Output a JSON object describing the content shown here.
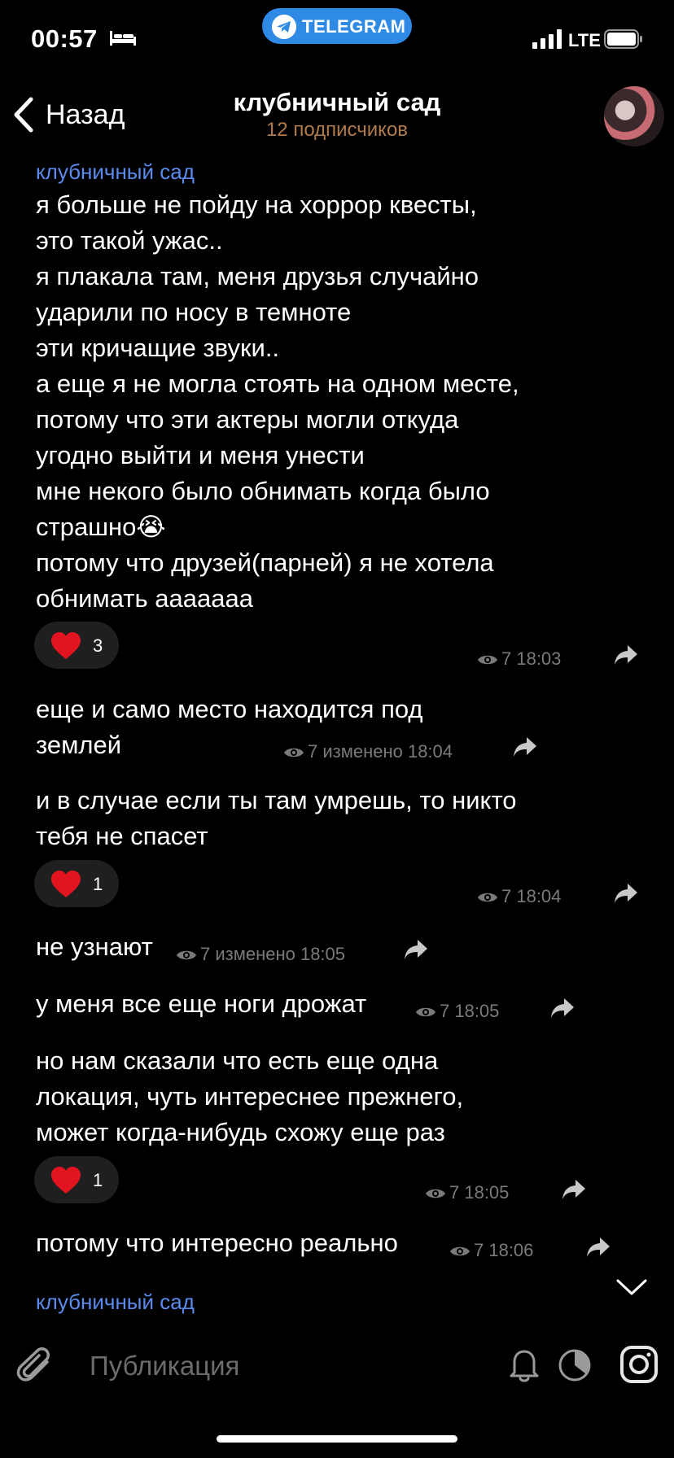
{
  "status_bar": {
    "time": "00:57",
    "tg_label": "TELEGRAM",
    "network": "LTE"
  },
  "header": {
    "back_label": "Назад",
    "title": "клубничный сад",
    "subtitle": "12 подписчиков"
  },
  "messages": {
    "m1": {
      "author": "клубничный сад",
      "text": "я больше не пойду на хоррор квесты,\nэто такой ужас..\nя плакала там, меня друзья случайно\nударили по носу в темноте\nэти кричащие звуки..\nа еще я не могла стоять на одном месте,\nпотому что эти актеры могли откуда\nугодно выйти и меня унести\nмне некого было обнимать когда было\nстрашно😭\nпотому что друзей(парней) я не хотела\nобнимать аааааaa",
      "reaction_count": "3",
      "meta": "7 18:03"
    },
    "m2": {
      "text": "еще и само место находится под\nземлей",
      "meta": "7 изменено 18:04"
    },
    "m3": {
      "text": "и в случае если ты там умрешь, то никто\nтебя не спасет",
      "reaction_count": "1",
      "meta": "7 18:04"
    },
    "m4": {
      "text": "не узнают",
      "meta": "7 изменено 18:05"
    },
    "m5": {
      "text": "у меня все еще ноги дрожат",
      "meta": "7 18:05"
    },
    "m6": {
      "text": "но нам сказали что есть еще одна\nлокация, чуть интереснее прежнего,\nможет когда-нибудь схожу еще раз",
      "reaction_count": "1",
      "meta": "7 18:05"
    },
    "m7": {
      "text": "потому что интересно реально",
      "meta": "7 18:06"
    },
    "m8": {
      "author": "клубничный сад"
    }
  },
  "composer": {
    "placeholder": "Публикация"
  },
  "icons": [
    "bed-icon",
    "telegram-icon",
    "signal-icon",
    "battery-icon",
    "chevron-left-icon",
    "heart-icon",
    "eye-icon",
    "share-icon",
    "chevron-down-icon",
    "paperclip-icon",
    "bell-icon",
    "timer-icon",
    "instagram-icon"
  ],
  "colors": {
    "accent_author": "#5b8bef",
    "subtitle": "#b07a4a",
    "telegram_pill": "#2f8ae5",
    "reaction_bg": "#1f1f1f"
  }
}
